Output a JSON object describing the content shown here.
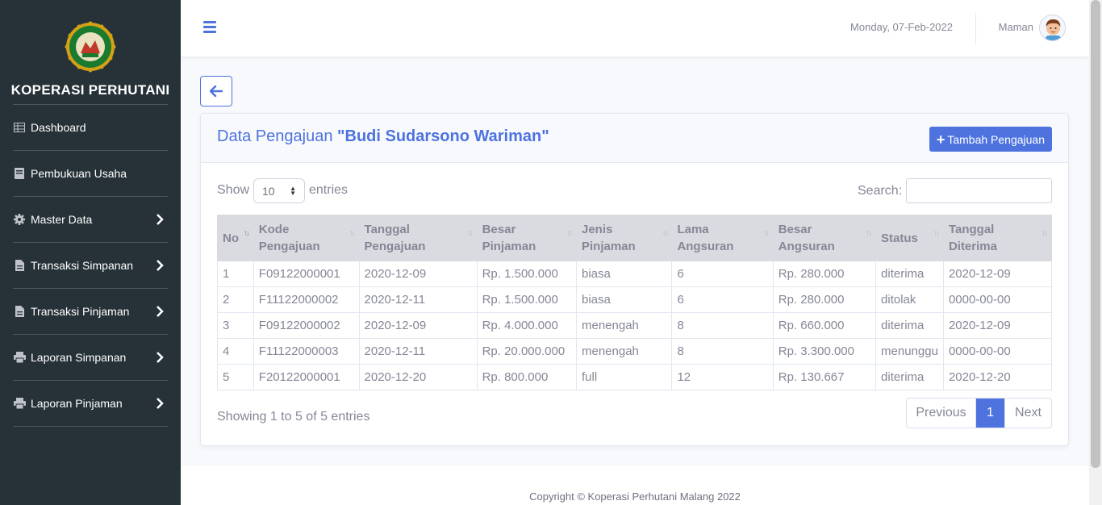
{
  "sidebar": {
    "brand": "KOPERASI PERHUTANI",
    "items": [
      {
        "label": "Dashboard",
        "icon": "table-icon",
        "has_submenu": false
      },
      {
        "label": "Pembukuan Usaha",
        "icon": "book-icon",
        "has_submenu": false
      },
      {
        "label": "Master Data",
        "icon": "gear-icon",
        "has_submenu": true
      },
      {
        "label": "Transaksi Simpanan",
        "icon": "file-icon",
        "has_submenu": true
      },
      {
        "label": "Transaksi Pinjaman",
        "icon": "file-icon",
        "has_submenu": true
      },
      {
        "label": "Laporan Simpanan",
        "icon": "printer-icon",
        "has_submenu": true
      },
      {
        "label": "Laporan Pinjaman",
        "icon": "printer-icon",
        "has_submenu": true
      }
    ]
  },
  "topbar": {
    "date": "Monday, 07-Feb-2022",
    "username": "Maman"
  },
  "card": {
    "title_prefix": "Data Pengajuan",
    "title_name": "\"Budi Sudarsono Wariman\"",
    "add_button": "Tambah Pengajuan"
  },
  "table_controls": {
    "show": "Show",
    "page_length": "10",
    "entries": "entries",
    "search": "Search:",
    "search_value": ""
  },
  "table": {
    "columns": [
      {
        "line1": "No",
        "line2": ""
      },
      {
        "line1": "Kode",
        "line2": "Pengajuan"
      },
      {
        "line1": "Tanggal",
        "line2": "Pengajuan"
      },
      {
        "line1": "Besar",
        "line2": "Pinjaman"
      },
      {
        "line1": "Jenis",
        "line2": "Pinjaman"
      },
      {
        "line1": "Lama",
        "line2": "Angsuran"
      },
      {
        "line1": "Besar",
        "line2": "Angsuran"
      },
      {
        "line1": "Status",
        "line2": ""
      },
      {
        "line1": "Tanggal",
        "line2": "Diterima"
      }
    ],
    "rows": [
      [
        "1",
        "F09122000001",
        "2020-12-09",
        "Rp. 1.500.000",
        "biasa",
        "6",
        "Rp. 280.000",
        "diterima",
        "2020-12-09"
      ],
      [
        "2",
        "F11122000002",
        "2020-12-11",
        "Rp. 1.500.000",
        "biasa",
        "6",
        "Rp. 280.000",
        "ditolak",
        "0000-00-00"
      ],
      [
        "3",
        "F09122000002",
        "2020-12-09",
        "Rp. 4.000.000",
        "menengah",
        "8",
        "Rp. 660.000",
        "diterima",
        "2020-12-09"
      ],
      [
        "4",
        "F11122000003",
        "2020-12-11",
        "Rp. 20.000.000",
        "menengah",
        "8",
        "Rp. 3.300.000",
        "menunggu",
        "0000-00-00"
      ],
      [
        "5",
        "F20122000001",
        "2020-12-20",
        "Rp. 800.000",
        "full",
        "12",
        "Rp. 130.667",
        "diterima",
        "2020-12-20"
      ]
    ]
  },
  "pagination": {
    "info": "Showing 1 to 5 of 5 entries",
    "previous": "Previous",
    "current": "1",
    "next": "Next"
  },
  "footer": {
    "text": "Copyright © Koperasi Perhutani Malang 2022"
  },
  "colors": {
    "primary": "#4e73df",
    "sidebar_bg": "#263238",
    "text_muted": "#858796"
  }
}
